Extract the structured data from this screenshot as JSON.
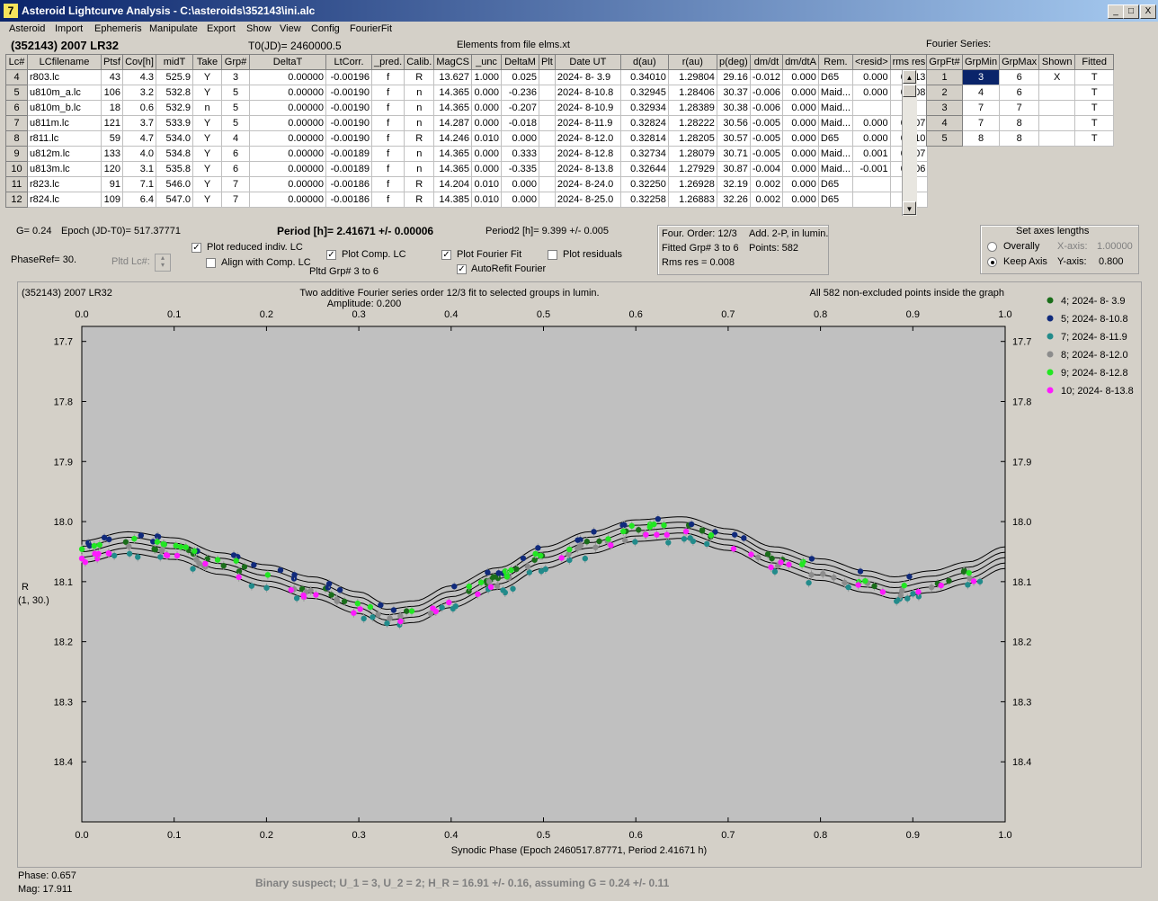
{
  "window": {
    "title": "Asteroid Lightcurve Analysis - C:\\asteroids\\352143\\ini.alc",
    "icon_letter": "7",
    "min_label": "_",
    "max_label": "□",
    "close_label": "X"
  },
  "menu": [
    "Asteroid",
    "Import",
    "Ephemeris",
    "Manipulate",
    "Export",
    "Show",
    "View",
    "Config",
    "FourierFit"
  ],
  "header": {
    "object": "(352143) 2007 LR32",
    "t0": "T0(JD)= 2460000.5",
    "elements": "Elements from file elms.xt"
  },
  "lc_table": {
    "columns": [
      "Lc#",
      "LCfilename",
      "Ptsf",
      "Cov[h]",
      "midT",
      "Take",
      "Grp#",
      "DeltaT",
      "LtCorr.",
      "_pred.",
      "Calib.",
      "MagCS",
      "_unc",
      "DeltaM",
      "Plt",
      "Date UT",
      "d(au)",
      "r(au)",
      "p(deg)",
      "dm/dt",
      "dm/dtA",
      "Rem.",
      "<resid>",
      "rms res"
    ],
    "rows": [
      [
        "4",
        "r803.lc",
        "43",
        "4.3",
        "525.9",
        "Y",
        "3",
        "0.00000",
        "-0.00196",
        "f",
        "R",
        "13.627",
        "1.000",
        "0.025",
        "",
        "2024- 8- 3.9",
        "0.34010",
        "1.29804",
        "29.16",
        "-0.012",
        "0.000",
        "D65",
        "0.000",
        "0.013"
      ],
      [
        "5",
        "u810m_a.lc",
        "106",
        "3.2",
        "532.8",
        "Y",
        "5",
        "0.00000",
        "-0.00190",
        "f",
        "n",
        "14.365",
        "0.000",
        "-0.236",
        "",
        "2024- 8-10.8",
        "0.32945",
        "1.28406",
        "30.37",
        "-0.006",
        "0.000",
        "Maid...",
        "0.000",
        "0.008"
      ],
      [
        "6",
        "u810m_b.lc",
        "18",
        "0.6",
        "532.9",
        "n",
        "5",
        "0.00000",
        "-0.00190",
        "f",
        "n",
        "14.365",
        "0.000",
        "-0.207",
        "",
        "2024- 8-10.9",
        "0.32934",
        "1.28389",
        "30.38",
        "-0.006",
        "0.000",
        "Maid...",
        "",
        ""
      ],
      [
        "7",
        "u811m.lc",
        "121",
        "3.7",
        "533.9",
        "Y",
        "5",
        "0.00000",
        "-0.00190",
        "f",
        "n",
        "14.287",
        "0.000",
        "-0.018",
        "",
        "2024- 8-11.9",
        "0.32824",
        "1.28222",
        "30.56",
        "-0.005",
        "0.000",
        "Maid...",
        "0.000",
        "0.007"
      ],
      [
        "8",
        "r811.lc",
        "59",
        "4.7",
        "534.0",
        "Y",
        "4",
        "0.00000",
        "-0.00190",
        "f",
        "R",
        "14.246",
        "0.010",
        "0.000",
        "",
        "2024- 8-12.0",
        "0.32814",
        "1.28205",
        "30.57",
        "-0.005",
        "0.000",
        "D65",
        "0.000",
        "0.010"
      ],
      [
        "9",
        "u812m.lc",
        "133",
        "4.0",
        "534.8",
        "Y",
        "6",
        "0.00000",
        "-0.00189",
        "f",
        "n",
        "14.365",
        "0.000",
        "0.333",
        "",
        "2024- 8-12.8",
        "0.32734",
        "1.28079",
        "30.71",
        "-0.005",
        "0.000",
        "Maid...",
        "0.001",
        "0.007"
      ],
      [
        "10",
        "u813m.lc",
        "120",
        "3.1",
        "535.8",
        "Y",
        "6",
        "0.00000",
        "-0.00189",
        "f",
        "n",
        "14.365",
        "0.000",
        "-0.335",
        "",
        "2024- 8-13.8",
        "0.32644",
        "1.27929",
        "30.87",
        "-0.004",
        "0.000",
        "Maid...",
        "-0.001",
        "0.006"
      ],
      [
        "11",
        "r823.lc",
        "91",
        "7.1",
        "546.0",
        "Y",
        "7",
        "0.00000",
        "-0.00186",
        "f",
        "R",
        "14.204",
        "0.010",
        "0.000",
        "",
        "2024- 8-24.0",
        "0.32250",
        "1.26928",
        "32.19",
        "0.002",
        "0.000",
        "D65",
        "",
        ""
      ],
      [
        "12",
        "r824.lc",
        "109",
        "6.4",
        "547.0",
        "Y",
        "7",
        "0.00000",
        "-0.00186",
        "f",
        "R",
        "14.385",
        "0.010",
        "0.000",
        "",
        "2024- 8-25.0",
        "0.32258",
        "1.26883",
        "32.26",
        "0.002",
        "0.000",
        "D65",
        "",
        ""
      ]
    ],
    "scroll_up": "▲",
    "scroll_down": "▼"
  },
  "fourier": {
    "title": "Fourier Series:",
    "columns": [
      "GrpFt#",
      "GrpMin",
      "GrpMax",
      "Shown",
      "Fitted"
    ],
    "rows": [
      [
        "1",
        "3",
        "6",
        "X",
        "T"
      ],
      [
        "2",
        "4",
        "6",
        "",
        "T"
      ],
      [
        "3",
        "7",
        "7",
        "",
        "T"
      ],
      [
        "4",
        "7",
        "8",
        "",
        "T"
      ],
      [
        "5",
        "8",
        "8",
        "",
        "T"
      ]
    ]
  },
  "controls": {
    "g": "G= 0.24",
    "epoch": "Epoch (JD-T0)= 517.37771",
    "period": "Period [h]= 2.41671 +/- 0.00006",
    "period2": "Period2 [h]= 9.399 +/- 0.005",
    "phaseref": "PhaseRef= 30.",
    "pltd_lc": "Pltd Lc#:",
    "plot_reduced": "Plot reduced indiv. LC",
    "align_comp": "Align with Comp. LC",
    "plot_comp": "Plot Comp. LC",
    "pltd_grp": "Pltd Grp#  3  to   6",
    "plot_fourier": "Plot Fourier Fit",
    "autorefit": "AutoRefit Fourier",
    "plot_resid": "Plot residuals",
    "check": "✓",
    "spin_up": "▴",
    "spin_down": "▾"
  },
  "fit_info": {
    "order": "Four. Order: 12/3",
    "add": "Add. 2-P, in lumin.",
    "fitted": "Fitted Grp# 3 to 6",
    "points": "Points: 582",
    "rms": "Rms res     = 0.008"
  },
  "axes": {
    "title": "Set axes lengths",
    "overally": "Overally",
    "keep": "Keep Axis",
    "xaxis_label": "X-axis:",
    "xaxis_value": "1.00000",
    "yaxis_label": "Y-axis:",
    "yaxis_value": "0.800"
  },
  "chart_data": {
    "type": "scatter",
    "object_label": "(352143) 2007 LR32",
    "title": "Two additive Fourier series order 12/3 fit to selected groups in lumin.",
    "subtitle": "Amplitude: 0.200",
    "note": "All 582 non-excluded points inside the graph",
    "xlabel": "Synodic Phase (Epoch 2460517.87771, Period 2.41671 h)",
    "ylabel": "R",
    "ylabel2": "(1, 30.)",
    "xlim": [
      0,
      1
    ],
    "ylim": [
      18.5,
      17.7
    ],
    "xticks": [
      "0.0",
      "0.1",
      "0.2",
      "0.3",
      "0.4",
      "0.5",
      "0.6",
      "0.7",
      "0.8",
      "0.9",
      "1.0"
    ],
    "yticks": [
      "17.7",
      "17.8",
      "17.9",
      "18.0",
      "18.1",
      "18.2",
      "18.3",
      "18.4"
    ],
    "fit_curve": {
      "x": [
        0.0,
        0.05,
        0.1,
        0.15,
        0.2,
        0.25,
        0.3,
        0.33,
        0.36,
        0.4,
        0.45,
        0.5,
        0.55,
        0.6,
        0.65,
        0.7,
        0.75,
        0.8,
        0.85,
        0.88,
        0.92,
        0.96,
        1.0
      ],
      "y": [
        18.05,
        18.035,
        18.045,
        18.07,
        18.09,
        18.11,
        18.135,
        18.155,
        18.15,
        18.125,
        18.095,
        18.06,
        18.035,
        18.015,
        18.01,
        18.03,
        18.06,
        18.08,
        18.1,
        18.11,
        18.1,
        18.085,
        18.06
      ]
    },
    "fit_offsets": [
      -0.018,
      -0.009,
      0,
      0.009,
      0.018
    ],
    "series": [
      {
        "name": "4; 2024- 8- 3.9",
        "color": "#1a6e1a",
        "offset": 0.0
      },
      {
        "name": "5; 2024- 8-10.8",
        "color": "#102a7c",
        "offset": -0.012
      },
      {
        "name": "7; 2024- 8-11.9",
        "color": "#228b8b",
        "offset": 0.02
      },
      {
        "name": "8; 2024- 8-12.0",
        "color": "#8c8c8c",
        "offset": 0.008
      },
      {
        "name": "9; 2024- 8-12.8",
        "color": "#22e622",
        "offset": -0.004
      },
      {
        "name": "10; 2024- 8-13.8",
        "color": "#ff19ff",
        "offset": 0.012
      }
    ]
  },
  "status": {
    "phase": "Phase:  0.657",
    "mag": "Mag:    17.911",
    "binary": "Binary suspect; U_1 = 3, U_2 = 2; H_R = 16.91 +/- 0.16, assuming G = 0.24 +/- 0.11"
  }
}
